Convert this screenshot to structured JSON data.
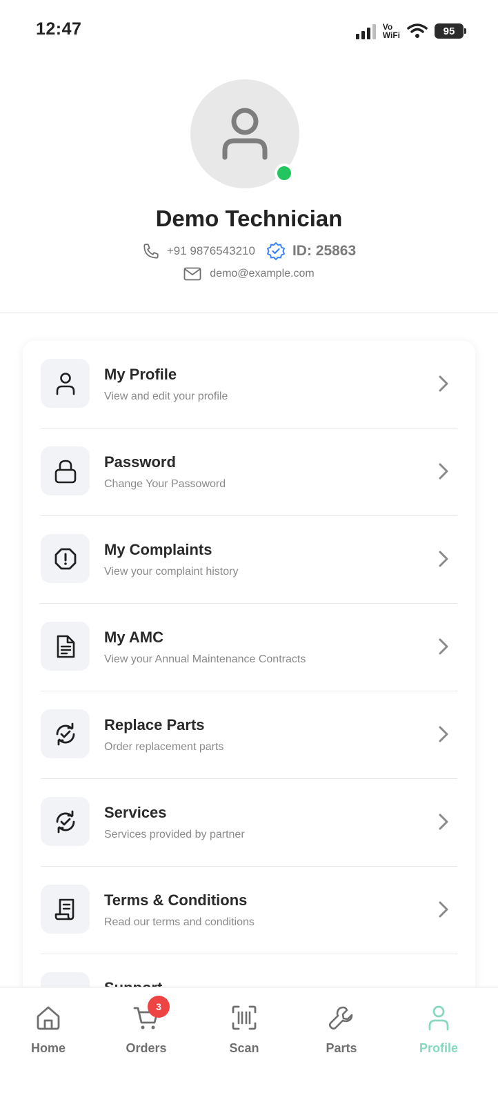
{
  "status_bar": {
    "time": "12:47",
    "network_line1": "Vo",
    "network_line2": "WiFi",
    "battery": "95"
  },
  "profile": {
    "name": "Demo Technician",
    "phone": "+91 9876543210",
    "id_label": "ID: 25863",
    "email": "demo@example.com",
    "online_color": "#22c55e"
  },
  "menu": {
    "items": [
      {
        "title": "My Profile",
        "subtitle": "View and edit your profile",
        "icon": "user-icon"
      },
      {
        "title": "Password",
        "subtitle": "Change Your Passoword",
        "icon": "lock-icon"
      },
      {
        "title": "My Complaints",
        "subtitle": "View your complaint history",
        "icon": "alert-octagon-icon"
      },
      {
        "title": "My AMC",
        "subtitle": "View your Annual Maintenance Contracts",
        "icon": "document-icon"
      },
      {
        "title": "Replace Parts",
        "subtitle": "Order replacement parts",
        "icon": "refresh-check-icon"
      },
      {
        "title": "Services",
        "subtitle": "Services provided by partner",
        "icon": "refresh-check-icon"
      },
      {
        "title": "Terms & Conditions",
        "subtitle": "Read our terms and conditions",
        "icon": "receipt-icon"
      },
      {
        "title": "Support",
        "subtitle": "",
        "icon": "support-icon"
      }
    ]
  },
  "bottom_nav": {
    "items": [
      {
        "label": "Home",
        "icon": "home-icon"
      },
      {
        "label": "Orders",
        "icon": "cart-icon",
        "badge": "3"
      },
      {
        "label": "Scan",
        "icon": "scan-icon"
      },
      {
        "label": "Parts",
        "icon": "wrench-icon"
      },
      {
        "label": "Profile",
        "icon": "user-icon"
      }
    ],
    "active": "Profile",
    "active_color": "#86d9c0"
  }
}
